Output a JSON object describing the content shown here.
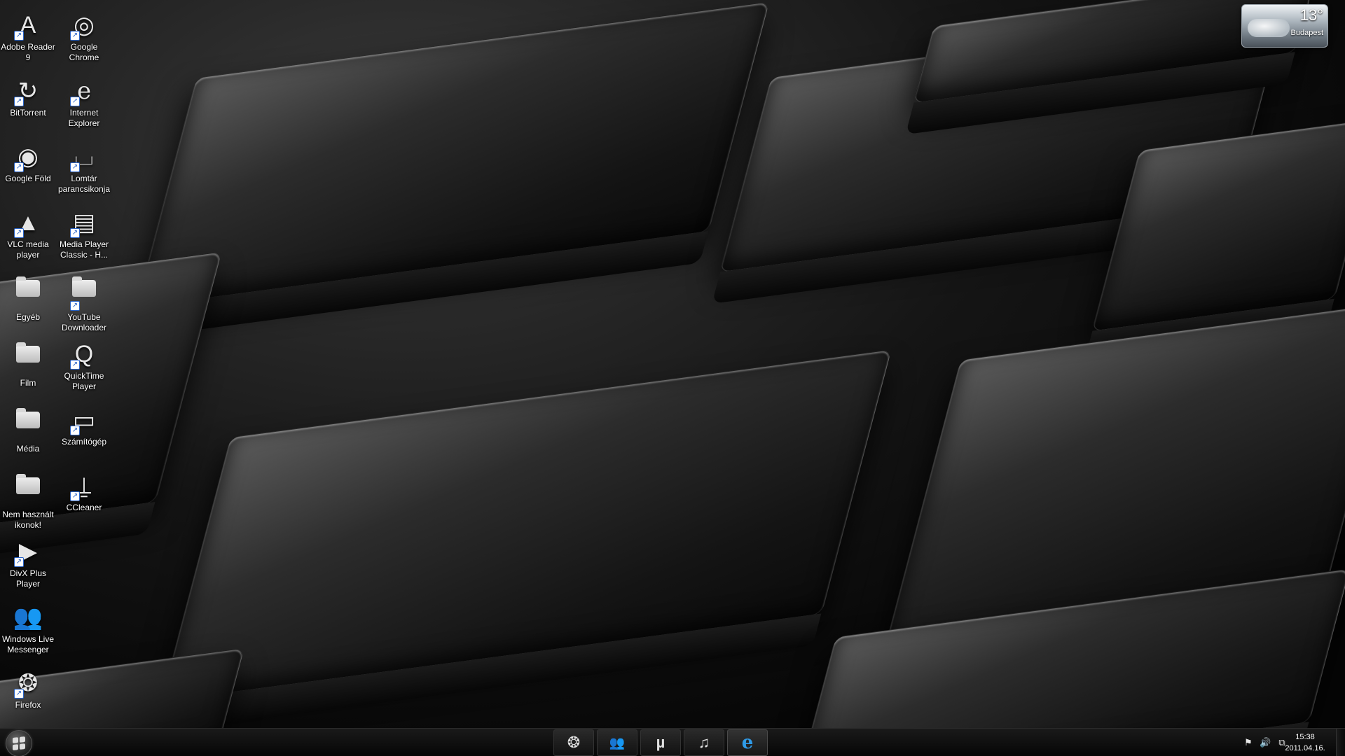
{
  "desktop_icons": [
    {
      "label": "Adobe Reader 9",
      "icon": "adobe-reader-icon",
      "shortcut": true
    },
    {
      "label": "Google Chrome",
      "icon": "chrome-icon",
      "shortcut": true
    },
    {
      "label": "BitTorrent",
      "icon": "bittorrent-icon",
      "shortcut": true
    },
    {
      "label": "Internet Explorer",
      "icon": "internet-explorer-icon",
      "shortcut": true
    },
    {
      "label": "Google Föld",
      "icon": "google-earth-icon",
      "shortcut": true
    },
    {
      "label": "Lomtár parancsikonja",
      "icon": "recycle-bin-icon",
      "shortcut": true
    },
    {
      "label": "VLC media player",
      "icon": "vlc-icon",
      "shortcut": true
    },
    {
      "label": "Media Player Classic - H...",
      "icon": "media-player-classic-icon",
      "shortcut": true
    },
    {
      "label": "Egyéb",
      "icon": "folder-icon",
      "shortcut": false
    },
    {
      "label": "YouTube Downloader",
      "icon": "folder-icon",
      "shortcut": true
    },
    {
      "label": "Film",
      "icon": "folder-icon",
      "shortcut": false
    },
    {
      "label": "QuickTime Player",
      "icon": "quicktime-icon",
      "shortcut": true
    },
    {
      "label": "Média",
      "icon": "folder-icon",
      "shortcut": false
    },
    {
      "label": "Számítógép",
      "icon": "computer-icon",
      "shortcut": true
    },
    {
      "label": "Nem használt ikonok!",
      "icon": "folder-icon",
      "shortcut": false
    },
    {
      "label": "CCleaner",
      "icon": "ccleaner-icon",
      "shortcut": true
    },
    {
      "label": "DivX Plus Player",
      "icon": "divx-icon",
      "shortcut": true
    },
    {
      "label": "Windows Live Messenger",
      "icon": "messenger-icon",
      "shortcut": false
    },
    {
      "label": "Firefox",
      "icon": "firefox-icon",
      "shortcut": true
    }
  ],
  "weather": {
    "temperature": "13°",
    "city": "Budapest",
    "icon": "cloud-icon"
  },
  "taskbar": {
    "start_icon": "windows-logo-icon",
    "pinned": [
      {
        "name": "firefox",
        "icon": "firefox-icon",
        "glyph": "❂",
        "active": false
      },
      {
        "name": "messenger",
        "icon": "messenger-icon",
        "glyph": "👥",
        "active": false
      },
      {
        "name": "utorrent",
        "icon": "utorrent-icon",
        "glyph": "µ",
        "active": false
      },
      {
        "name": "music",
        "icon": "music-note-icon",
        "glyph": "♫",
        "active": false
      },
      {
        "name": "internet-explorer",
        "icon": "internet-explorer-icon",
        "glyph": "e",
        "active": true
      }
    ],
    "tray": {
      "icons": [
        "flag-icon",
        "speaker-icon",
        "network-icon"
      ],
      "time": "15:38",
      "date": "2011.04.16."
    }
  },
  "colors": {
    "ie_blue": "#2f9be8",
    "shortcut_arrow": "#2a64c8"
  }
}
